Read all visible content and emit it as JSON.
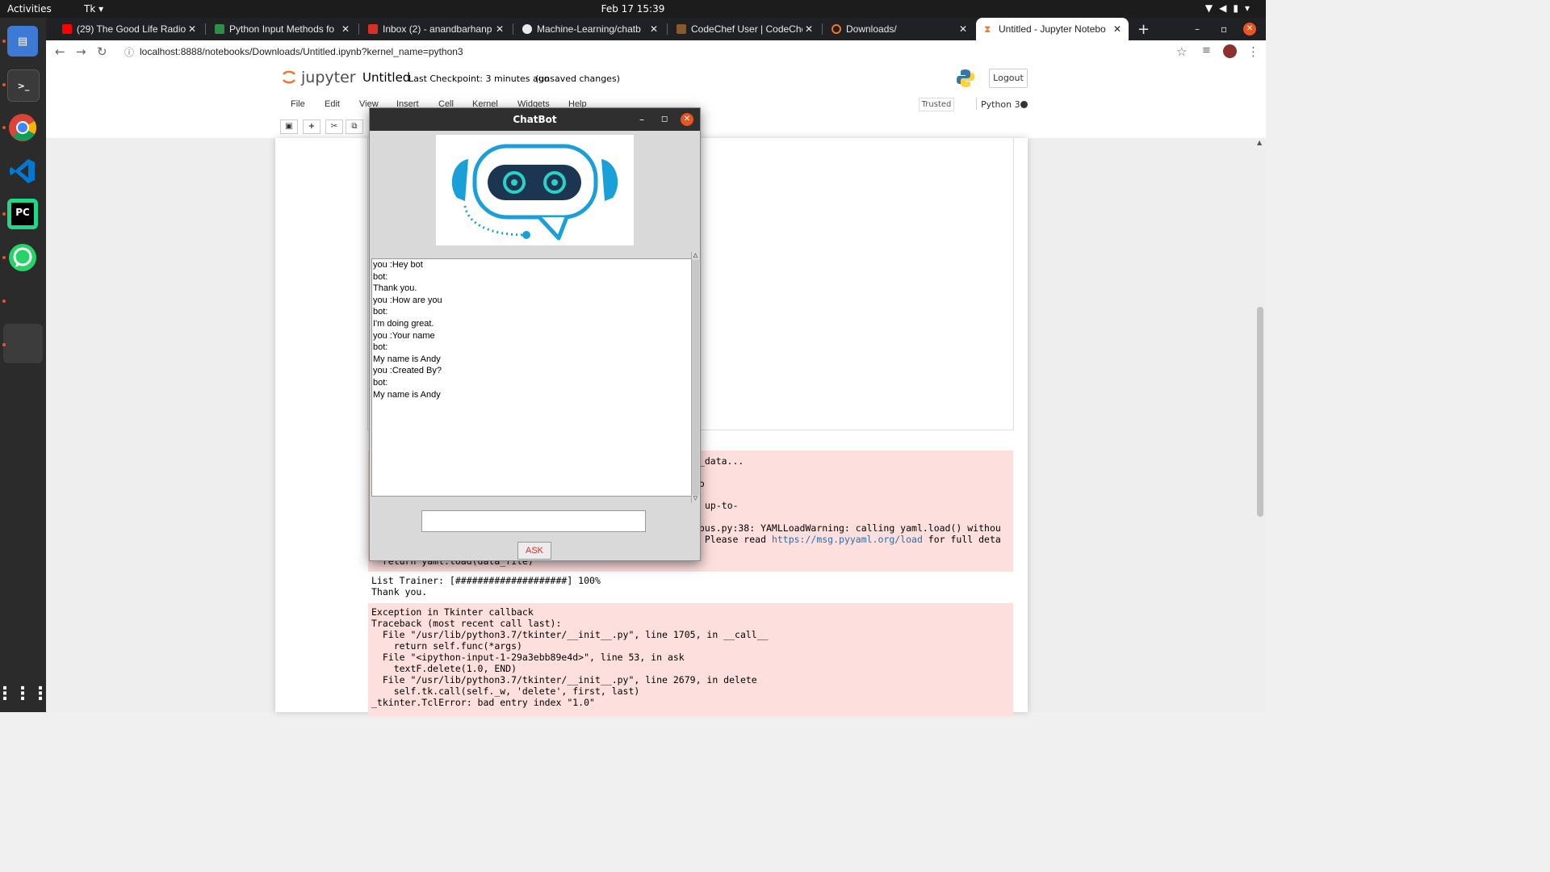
{
  "topbar": {
    "activities": "Activities",
    "app_menu": "Tk",
    "clock": "Feb 17  15:39"
  },
  "tabs": [
    {
      "label": "(29) The Good Life Radio",
      "icon": "youtube-icon",
      "color": "#ff0000"
    },
    {
      "label": "Python Input Methods fo",
      "icon": "gfg-icon",
      "color": "#2f8d46"
    },
    {
      "label": "Inbox (2) - anandbarhanp",
      "icon": "gmail-icon",
      "color": "#d93025"
    },
    {
      "label": "Machine-Learning/chatb",
      "icon": "github-icon",
      "color": "#ffffff"
    },
    {
      "label": "CodeChef User | CodeChe",
      "icon": "codechef-icon",
      "color": "#8b5a2b"
    },
    {
      "label": "Downloads/",
      "icon": "jupyter-icon",
      "color": "#f37626"
    },
    {
      "label": "Untitled - Jupyter Notebo",
      "icon": "hourglass-icon",
      "color": "#f37626"
    }
  ],
  "address": {
    "url": "localhost:8888/notebooks/Downloads/Untitled.ipynb?kernel_name=python3"
  },
  "jupyter": {
    "logo_text": "jupyter",
    "notebook_name": "Untitled",
    "checkpoint": "Last Checkpoint: 3 minutes ago",
    "unsaved": "(unsaved changes)",
    "logout": "Logout",
    "trusted": "Trusted",
    "kernel": "Python 3",
    "menu": [
      "File",
      "Edit",
      "View",
      "Insert",
      "Cell",
      "Kernel",
      "Widgets",
      "Help"
    ]
  },
  "output": {
    "warn_lines": [
      "k_data...",
      "",
      "to",
      "",
      "up-to-",
      "",
      "rpus.py:38: YAMLLoadWarning: calling yaml.load() withou",
      ". Please read ",
      "  return yaml.load(data_file)"
    ],
    "warn_link": "https://msg.pyyaml.org/load",
    "warn_link_suffix": " for full deta",
    "trainer": "List Trainer: [####################] 100%",
    "thank": "Thank you.",
    "traceback": [
      "Exception in Tkinter callback",
      "Traceback (most recent call last):",
      "  File \"/usr/lib/python3.7/tkinter/__init__.py\", line 1705, in __call__",
      "    return self.func(*args)",
      "  File \"<ipython-input-1-29a3ebb89e4d>\", line 53, in ask",
      "    textF.delete(1.0, END)",
      "  File \"/usr/lib/python3.7/tkinter/__init__.py\", line 2679, in delete",
      "    self.tk.call(self._w, 'delete', first, last)",
      "_tkinter.TclError: bad entry index \"1.0\""
    ]
  },
  "chatbot": {
    "title": "ChatBot",
    "ask_label": "ASK",
    "input_value": "",
    "log": [
      "you :Hey bot",
      "bot:",
      "Thank you.",
      "you :How are you",
      "bot:",
      "I'm doing great.",
      "you :Your name",
      "bot:",
      "My name is Andy",
      "you :Created By?",
      "bot:",
      "My name is Andy"
    ]
  }
}
